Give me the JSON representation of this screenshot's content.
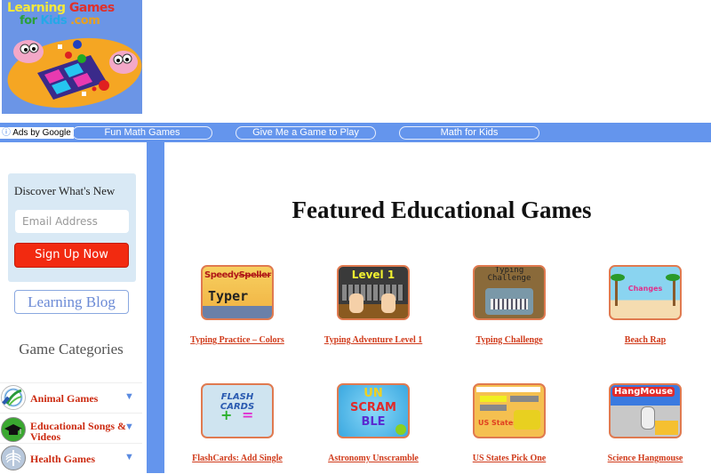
{
  "logo": {
    "line1": [
      "Learning",
      "Games"
    ],
    "line2": [
      "for",
      "Kids",
      ".com"
    ],
    "alt": "Learning Games for Kids logo"
  },
  "nav": {
    "ads_label": "Ads by Google",
    "links": [
      "Fun Math Games",
      "Give Me a Game to Play",
      "Math for Kids"
    ]
  },
  "signup": {
    "title": "Discover What's New",
    "email_placeholder": "Email Address",
    "button_label": "Sign Up Now"
  },
  "blog_button": "Learning Blog",
  "categories": {
    "title": "Game Categories",
    "items": [
      {
        "label": "Animal Games",
        "icon": "animal-icon"
      },
      {
        "label": "Educational Songs & Videos",
        "icon": "graduation-cap-icon"
      },
      {
        "label": "Health Games",
        "icon": "xray-chest-icon"
      }
    ],
    "expand_arrow": "▼"
  },
  "main": {
    "heading": "Featured Educational Games",
    "games": [
      {
        "title": "Typing Practice – Colors",
        "thumb_text": [
          "Speedy",
          "Speller",
          "Typer"
        ]
      },
      {
        "title": "Typing Adventure Level 1",
        "thumb_text": [
          "Level 1"
        ]
      },
      {
        "title": "Typing Challenge",
        "thumb_text": [
          "Typing",
          "Challenge"
        ]
      },
      {
        "title": "Beach Rap",
        "thumb_text": [
          "Changes"
        ]
      },
      {
        "title": "FlashCards: Add Single",
        "thumb_text": [
          "FLASH CARDS",
          "+",
          "="
        ]
      },
      {
        "title": "Astronomy Unscramble",
        "thumb_text": [
          "UN",
          "SCRAM",
          "BLE"
        ]
      },
      {
        "title": "US States Pick One",
        "thumb_text": [
          "US States"
        ]
      },
      {
        "title": "Science Hangmouse",
        "thumb_text": [
          "HangMouse"
        ]
      }
    ]
  }
}
